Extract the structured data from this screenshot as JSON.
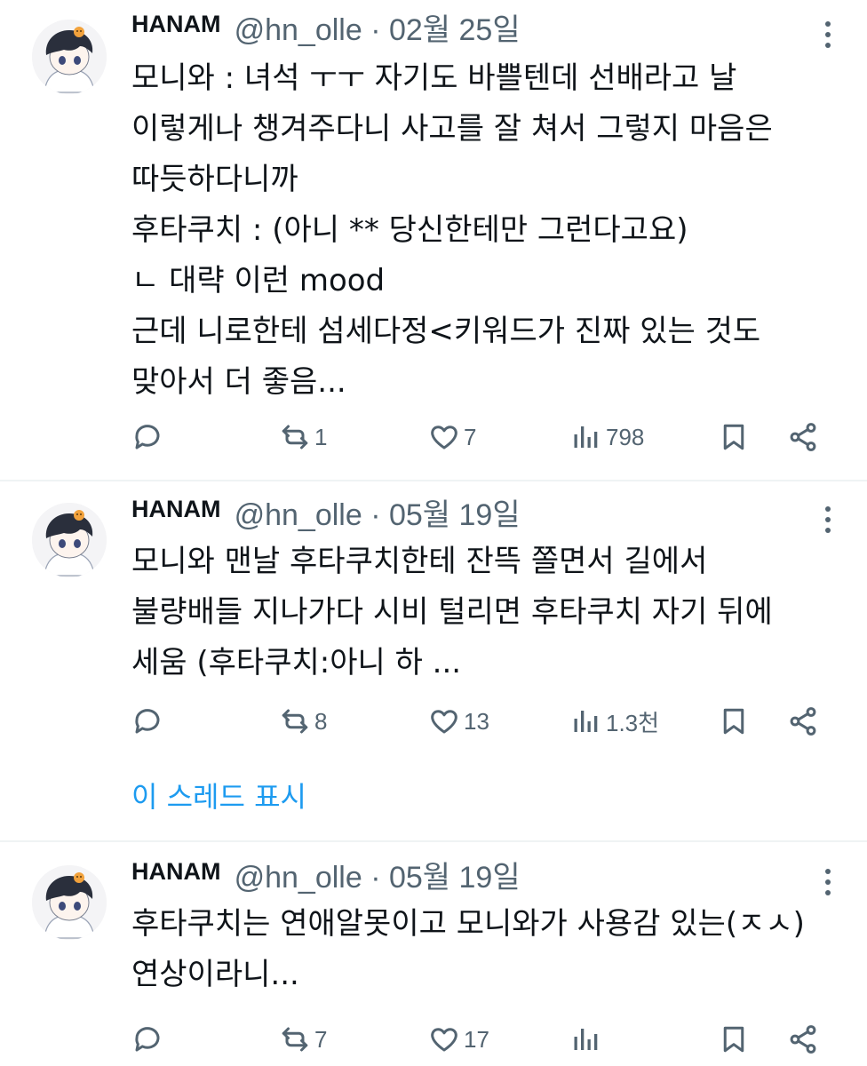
{
  "tweets": [
    {
      "name": "HANAM",
      "handle": "@hn_olle · 02월 25일",
      "text": "모니와 : 녀석 ㅜㅜ 자기도 바쁠텐데 선배라고 날\n이렇게나 챙겨주다니 사고를 잘 쳐서 그렇지 마음은\n따듯하다니까\n후타쿠치 : (아니 ** 당신한테만 그런다고요)\nㄴ 대략 이런 mood\n근데 니로한테 섬세다정<키워드가 진짜 있는 것도\n맞아서 더 좋음...",
      "retweets": "1",
      "likes": "7",
      "views": "798"
    },
    {
      "name": "HANAM",
      "handle": "@hn_olle · 05월 19일",
      "text": "모니와 맨날 후타쿠치한테 잔뜩 쫄면서 길에서\n불량배들 지나가다 시비 털리면 후타쿠치 자기 뒤에\n세움 (후타쿠치:아니 하 ...",
      "retweets": "8",
      "likes": "13",
      "views": "1.3천"
    },
    {
      "name": "HANAM",
      "handle": "@hn_olle · 05월 19일",
      "text": "후타쿠치는 연애알못이고 모니와가 사용감 있는(ㅈㅅ)\n연상이라니...",
      "retweets": "7",
      "likes": "17",
      "views": ""
    }
  ],
  "show_thread_label": "이 스레드 표시",
  "icons": {
    "reply": "reply-icon",
    "retweet": "retweet-icon",
    "like": "heart-icon",
    "views": "views-icon",
    "bookmark": "bookmark-icon",
    "share": "share-icon",
    "more": "more-icon"
  },
  "colors": {
    "text": "#0f1419",
    "secondary": "#536471",
    "link": "#1d9bf0",
    "divider": "#eff3f4"
  }
}
